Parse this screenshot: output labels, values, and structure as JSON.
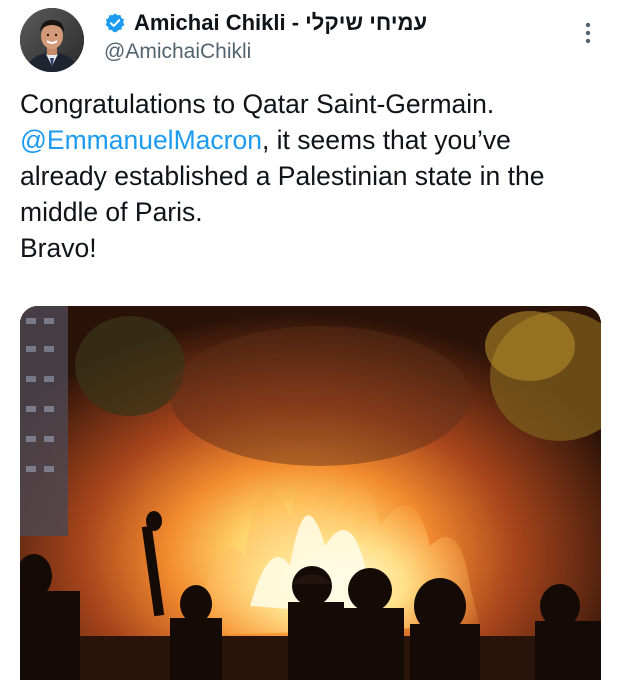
{
  "tweet": {
    "author": {
      "display_name": "Amichai Chikli - עמיחי שיקלי",
      "handle": "@AmichaiChikli",
      "verified": true,
      "avatar_icon": "person-avatar"
    },
    "text": {
      "line1": "Congratulations to Qatar Saint-Germain.",
      "mention": "@EmmanuelMacron",
      "after_mention": ", it seems that you’ve already established a Palestinian state in the middle of Paris.",
      "closing": "Bravo!"
    },
    "media": {
      "kind": "photo",
      "description_icon": "fire-scene-photo"
    },
    "colors": {
      "text": "#0f1419",
      "secondary": "#536471",
      "accent": "#1d9bf0"
    }
  }
}
